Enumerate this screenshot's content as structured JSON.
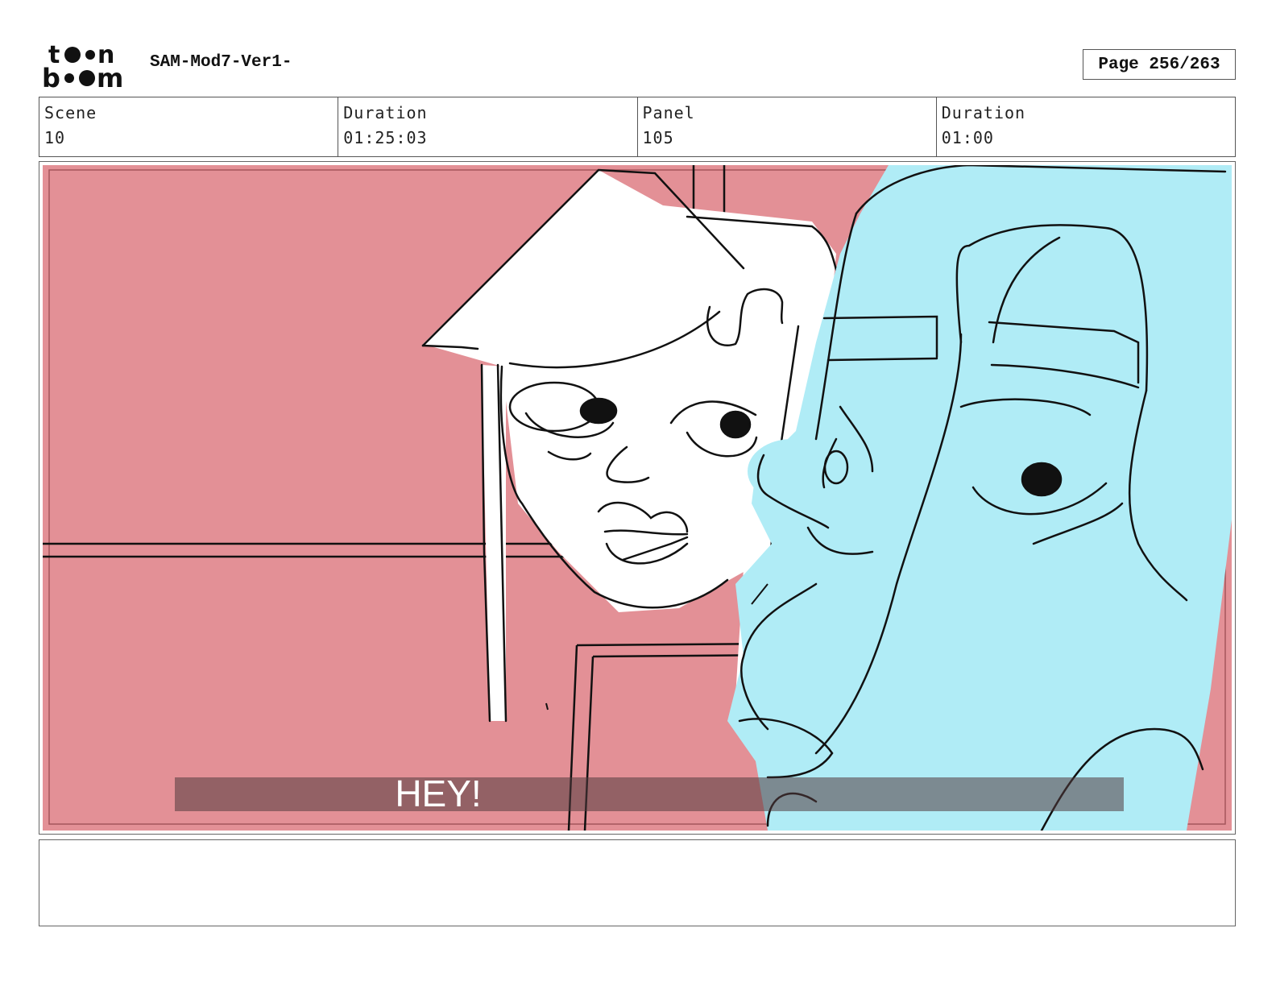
{
  "header": {
    "logo_text": "toon boom",
    "project_title": "SAM-Mod7-Ver1-",
    "page": "Page 256/263"
  },
  "info": {
    "scene_label": "Scene",
    "scene_value": "10",
    "scene_duration_label": "Duration",
    "scene_duration_value": "01:25:03",
    "panel_label": "Panel",
    "panel_value": "105",
    "panel_duration_label": "Duration",
    "panel_duration_value": "01:00"
  },
  "panel": {
    "subtitle": "HEY!",
    "colors": {
      "background": "#e39096",
      "character_right": "#b0ecf6",
      "character_left": "#ffffff",
      "ink": "#111111"
    }
  },
  "notes": {
    "text": ""
  }
}
